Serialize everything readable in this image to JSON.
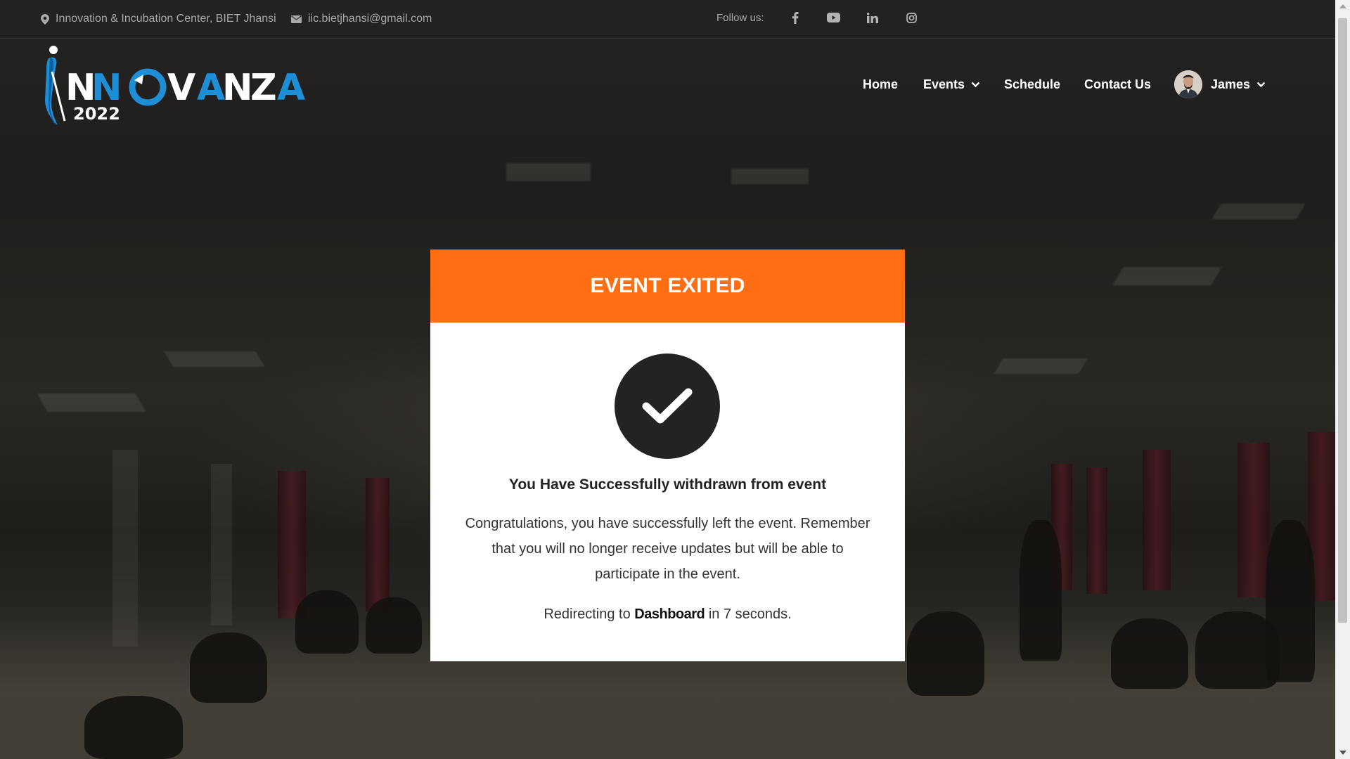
{
  "topbar": {
    "location": "Innovation & Incubation Center, BIET Jhansi",
    "email": "iic.bietjhansi@gmail.com",
    "follow_label": "Follow us:",
    "social_icons": [
      "facebook-icon",
      "youtube-icon",
      "linkedin-icon",
      "instagram-icon"
    ]
  },
  "logo": {
    "text": "INNOVANZA",
    "year": "2022"
  },
  "nav": {
    "home": "Home",
    "events": "Events",
    "schedule": "Schedule",
    "contact": "Contact Us",
    "user": "James"
  },
  "card": {
    "title": "EVENT EXITED",
    "heading": "You Have Successfully withdrawn from event",
    "message": "Congratulations, you have successfully left the event. Remember that you will no longer receive updates but will be able to participate in the event.",
    "redirect_prefix": "Redirecting to",
    "redirect_link": "Dashboard",
    "redirect_suffix": "in 7 seconds."
  },
  "colors": {
    "accent": "#ff6e12",
    "logo_blue": "#1e8fd6",
    "check_bg": "#232323"
  }
}
